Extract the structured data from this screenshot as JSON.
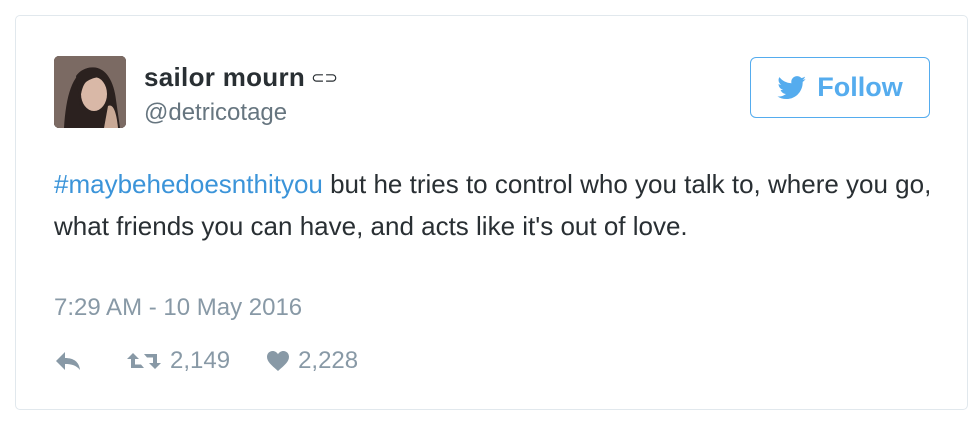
{
  "tweet": {
    "user": {
      "display_name": "sailor mourn",
      "name_glyph": "⊂⊃",
      "handle": "@detricotage",
      "avatar_icon": "user-avatar-photo"
    },
    "follow_button": {
      "label": "Follow",
      "icon": "twitter-bird-icon",
      "color": "#55acee"
    },
    "text": {
      "hashtag": "#maybehedoesnthityou",
      "body": " but he tries to control who you talk to, where you go, what friends you can have, and acts like it's out of love.",
      "hashtag_color": "#3b94d9"
    },
    "timestamp": "7:29 AM - 10 May 2016",
    "actions": {
      "reply_icon": "reply-icon",
      "retweet_icon": "retweet-icon",
      "retweet_count": "2,149",
      "like_icon": "heart-icon",
      "like_count": "2,228"
    }
  }
}
